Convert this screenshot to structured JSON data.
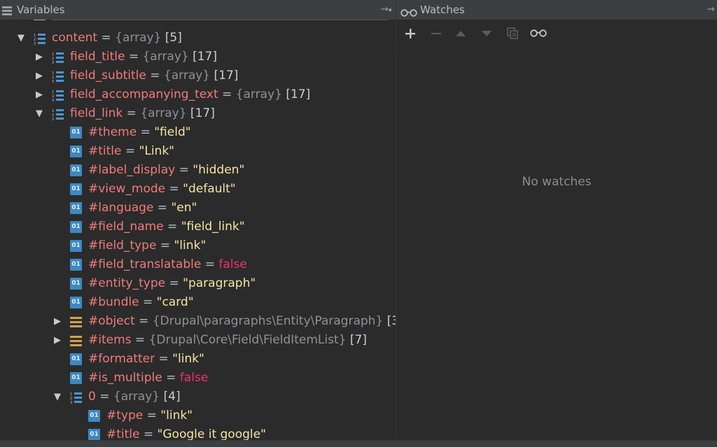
{
  "variables_panel": {
    "title": "Variables",
    "rows": [
      {
        "name": "content",
        "type": "{array}",
        "count": "[5]",
        "icon": "array-icon",
        "expanded": true,
        "indent": 0
      },
      {
        "name": "field_title",
        "type": "{array}",
        "count": "[17]",
        "icon": "array-icon",
        "expanded": false,
        "indent": 1
      },
      {
        "name": "field_subtitle",
        "type": "{array}",
        "count": "[17]",
        "icon": "array-icon",
        "expanded": false,
        "indent": 1
      },
      {
        "name": "field_accompanying_text",
        "type": "{array}",
        "count": "[17]",
        "icon": "array-icon",
        "expanded": false,
        "indent": 1
      },
      {
        "name": "field_link",
        "type": "{array}",
        "count": "[17]",
        "icon": "array-icon",
        "expanded": true,
        "indent": 1
      },
      {
        "name": "#theme",
        "value": "\"field\"",
        "icon": "primitive-icon",
        "indent": 2
      },
      {
        "name": "#title",
        "value": "\"Link\"",
        "icon": "primitive-icon",
        "indent": 2
      },
      {
        "name": "#label_display",
        "value": "\"hidden\"",
        "icon": "primitive-icon",
        "indent": 2
      },
      {
        "name": "#view_mode",
        "value": "\"default\"",
        "icon": "primitive-icon",
        "indent": 2
      },
      {
        "name": "#language",
        "value": "\"en\"",
        "icon": "primitive-icon",
        "indent": 2
      },
      {
        "name": "#field_name",
        "value": "\"field_link\"",
        "icon": "primitive-icon",
        "indent": 2
      },
      {
        "name": "#field_type",
        "value": "\"link\"",
        "icon": "primitive-icon",
        "indent": 2
      },
      {
        "name": "#field_translatable",
        "bool": "false",
        "icon": "primitive-icon",
        "indent": 2
      },
      {
        "name": "#entity_type",
        "value": "\"paragraph\"",
        "icon": "primitive-icon",
        "indent": 2
      },
      {
        "name": "#bundle",
        "value": "\"card\"",
        "icon": "primitive-icon",
        "indent": 2
      },
      {
        "name": "#object",
        "type": "{Drupal\\paragraphs\\Entity\\Paragraph}",
        "count": "[3",
        "icon": "object-icon",
        "expanded": false,
        "indent": 2
      },
      {
        "name": "#items",
        "type": "{Drupal\\Core\\Field\\FieldItemList}",
        "count": "[7]",
        "icon": "object-icon",
        "expanded": false,
        "indent": 2
      },
      {
        "name": "#formatter",
        "value": "\"link\"",
        "icon": "primitive-icon",
        "indent": 2
      },
      {
        "name": "#is_multiple",
        "bool": "false",
        "icon": "primitive-icon",
        "indent": 2
      },
      {
        "name": "0",
        "type": "{array}",
        "count": "[4]",
        "icon": "array-icon",
        "expanded": true,
        "indent": 2
      },
      {
        "name": "#type",
        "value": "\"link\"",
        "icon": "primitive-icon",
        "indent": 3
      },
      {
        "name": "#title",
        "value": "\"Google it google\"",
        "icon": "primitive-icon",
        "indent": 3
      }
    ]
  },
  "watches_panel": {
    "title": "Watches",
    "empty_text": "No watches",
    "toolbar": [
      "add-icon",
      "remove-icon",
      "move-up-icon",
      "move-down-icon",
      "duplicate-icon",
      "glasses-icon"
    ]
  },
  "symbols": {
    "operator": " = ",
    "expanded_arrow": "▼",
    "collapsed_arrow": "▶"
  },
  "colors": {
    "name": "#ef7b7b",
    "string": "#f4e4a4",
    "false": "#f02f73",
    "type": "#8d9298",
    "background": "#2b2b2b",
    "header": "#3c3f41"
  }
}
